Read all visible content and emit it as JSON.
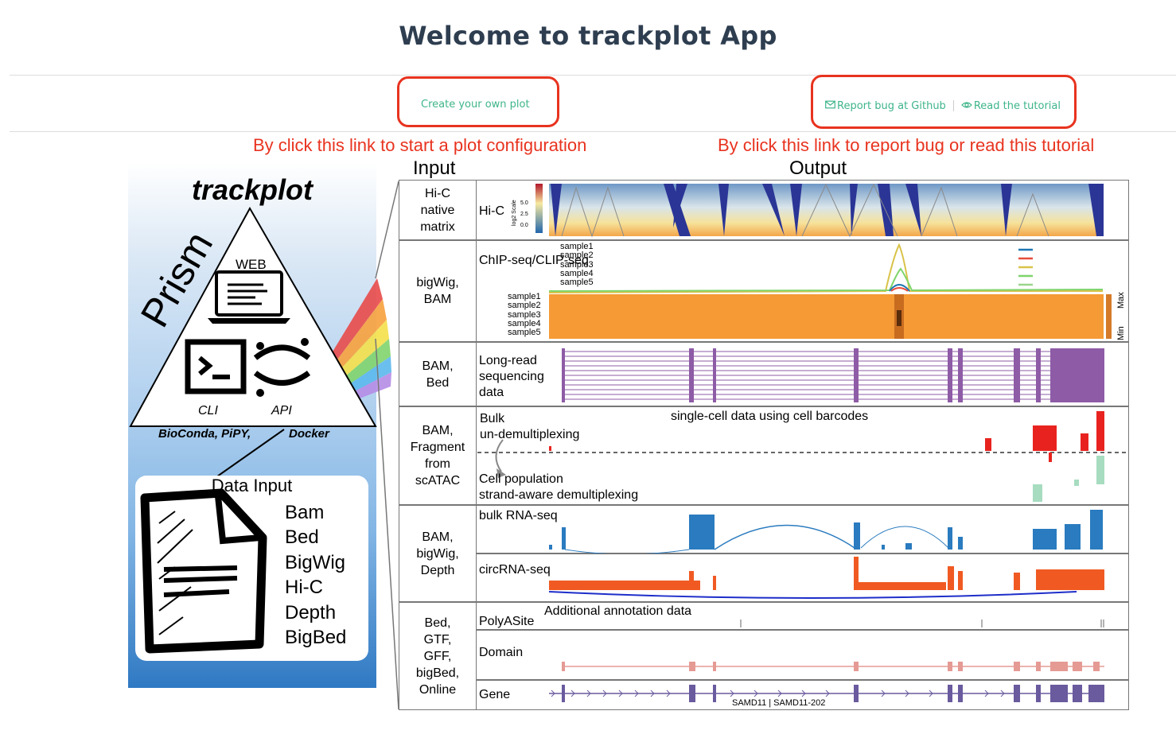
{
  "header": {
    "title": "Welcome to trackplot App"
  },
  "nav": {
    "create_label": "Create your own plot",
    "report_label": "Report bug at Github",
    "tutorial_label": "Read the tutorial"
  },
  "annotations": {
    "left": "By click this link to start a plot configuration",
    "right": "By click this link to report bug or read this tutorial"
  },
  "figure": {
    "input_header": "Input",
    "output_header": "Output",
    "brand": "trackplot",
    "prism": "Prism",
    "web": "WEB",
    "cli": "CLI",
    "api": "API",
    "channels": "BioConda, PiPY,",
    "docker": "Docker",
    "data_input": "Data Input",
    "formats": [
      "Bam",
      "Bed",
      "BigWig",
      "Hi-C",
      "Depth",
      "BigBed"
    ],
    "inputs": [
      [
        "Hi-C",
        "native",
        "matrix"
      ],
      [
        "bigWig,",
        "BAM"
      ],
      [
        "BAM,",
        "Bed"
      ],
      [
        "BAM,",
        "Fragment",
        "from",
        "scATAC"
      ],
      [
        "BAM,",
        "bigWig,",
        "Depth"
      ],
      [
        "Bed,",
        "GTF,",
        "GFF,",
        "bigBed,",
        "Online"
      ]
    ],
    "tracks": {
      "hic": "Hi-C",
      "hic_scale": "log2 Scale",
      "hic_ticks": [
        "5.0",
        "2.5",
        "0.0"
      ],
      "chip": "ChIP-seq/CLIP-seq",
      "samples": [
        "sample1",
        "sample2",
        "sample3",
        "sample4",
        "sample5"
      ],
      "max": "Max",
      "min": "Min",
      "longread": [
        "Long-read",
        "sequencing",
        "data"
      ],
      "sc_title": "single-cell data using cell barcodes",
      "bulk": [
        "Bulk",
        "un-demultiplexing"
      ],
      "cellpop": [
        "Cell population",
        "strand-aware demultiplexing"
      ],
      "rnaseq": "bulk RNA-seq",
      "circ": "circRNA-seq",
      "annot_title": "Additional annotation data",
      "polya": "PolyASite",
      "domain": "Domain",
      "gene": "Gene",
      "gene_name": "SAMD11 | SAMD11-202"
    }
  },
  "colors": {
    "accent": "#3eb58a",
    "annotation_red": "#e8331f",
    "title": "#2e3e50"
  }
}
